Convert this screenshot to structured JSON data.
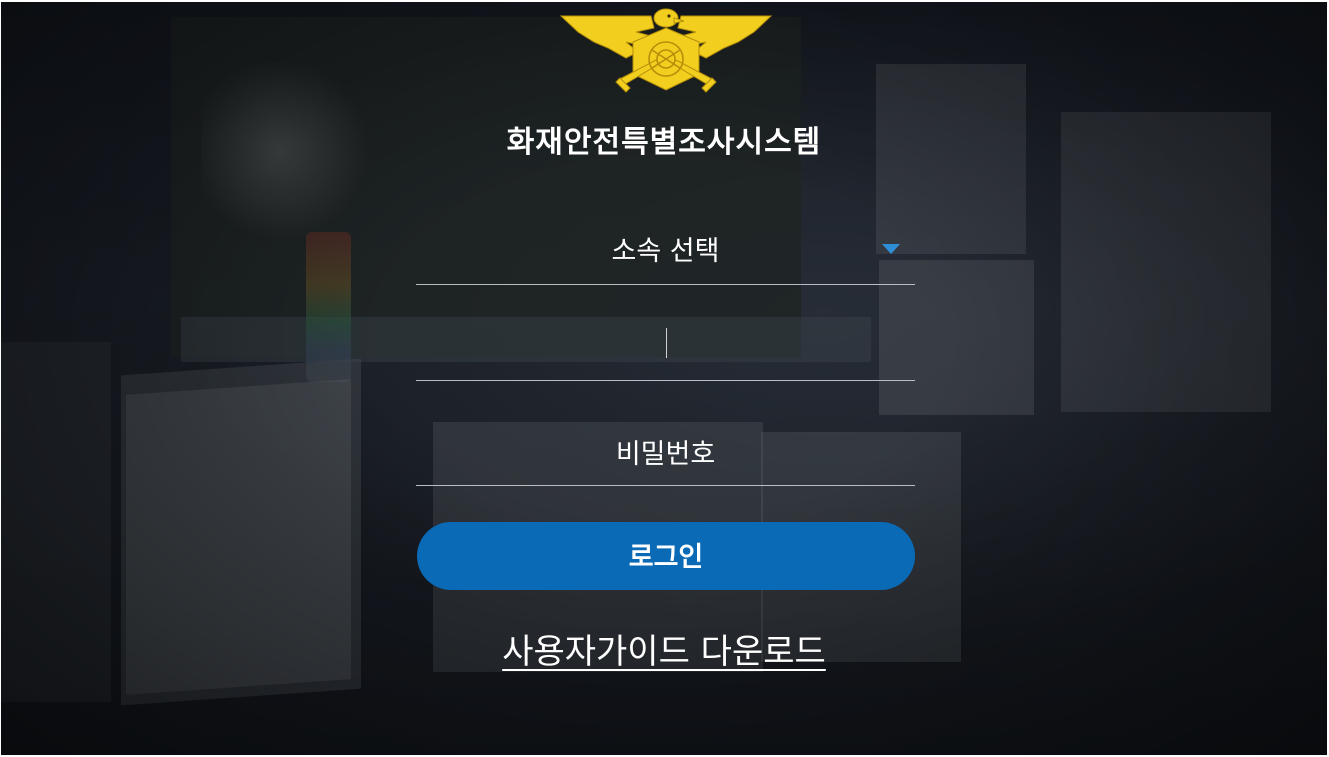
{
  "app": {
    "title": "화재안전특별조사시스템"
  },
  "login_form": {
    "affiliation_select": {
      "selected_label": "소속 선택"
    },
    "user_id": {
      "value": ""
    },
    "password": {
      "placeholder": "비밀번호"
    },
    "login_button_label": "로그인",
    "guide_link_label": "사용자가이드 다운로드"
  },
  "icons": {
    "emblem": "fire-service-eagle-emblem",
    "select_arrow": "triangle-down-icon"
  },
  "colors": {
    "primary_button": "#0a6ab5",
    "emblem_gold": "#f2cf1f",
    "select_arrow": "#2f8fd6",
    "text": "#ffffff"
  }
}
